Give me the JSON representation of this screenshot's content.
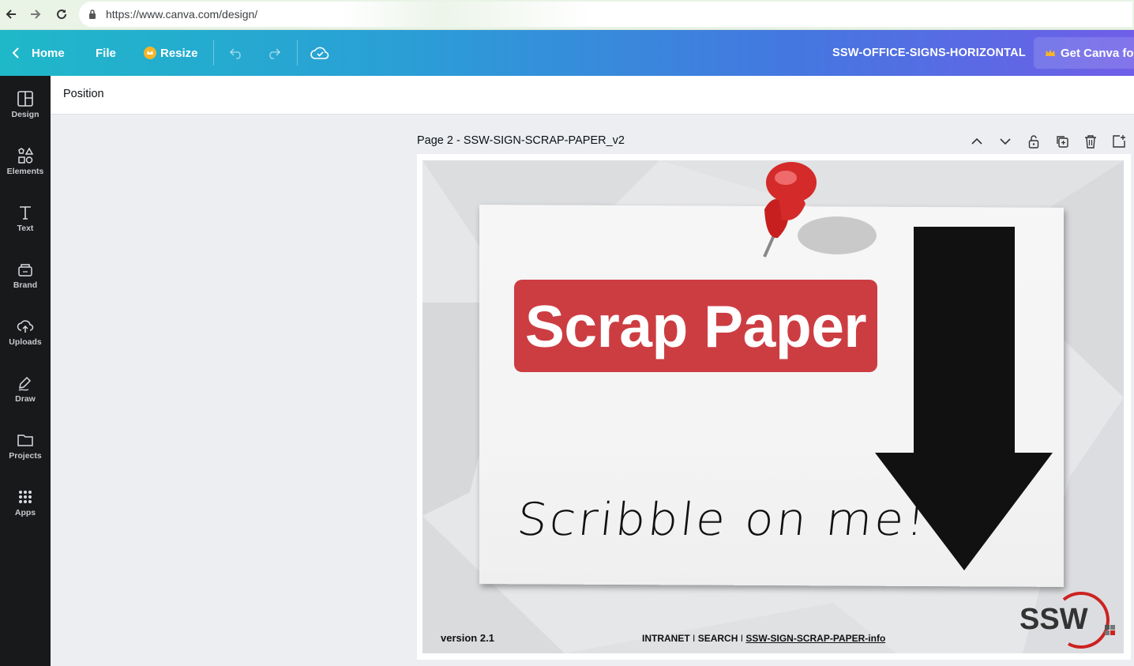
{
  "browser": {
    "url": "https://www.canva.com/design/"
  },
  "topbar": {
    "home_label": "Home",
    "file_label": "File",
    "resize_label": "Resize",
    "design_title": "SSW-OFFICE-SIGNS-HORIZONTAL",
    "get_canva_label": "Get Canva for"
  },
  "sidebar": {
    "items": [
      {
        "label": "Design",
        "icon": "layout-icon"
      },
      {
        "label": "Elements",
        "icon": "shapes-icon"
      },
      {
        "label": "Text",
        "icon": "text-icon"
      },
      {
        "label": "Brand",
        "icon": "brand-icon"
      },
      {
        "label": "Uploads",
        "icon": "cloud-upload-icon"
      },
      {
        "label": "Draw",
        "icon": "pen-icon"
      },
      {
        "label": "Projects",
        "icon": "folder-icon"
      },
      {
        "label": "Apps",
        "icon": "grid-icon"
      }
    ]
  },
  "context_bar": {
    "position_label": "Position"
  },
  "page": {
    "label": "Page 2 - SSW-SIGN-SCRAP-PAPER_v2"
  },
  "design": {
    "title": "Scrap Paper",
    "scribble": "Scribble on me!",
    "version": "version 2.1",
    "footer": {
      "intranet": "INTRANET",
      "search": "SEARCH",
      "info_link": "SSW-SIGN-SCRAP-PAPER-info",
      "separator": "I"
    },
    "logo_text": "SSW",
    "colors": {
      "title_bg": "#cc3d42",
      "pin_red": "#d42a2a"
    }
  }
}
